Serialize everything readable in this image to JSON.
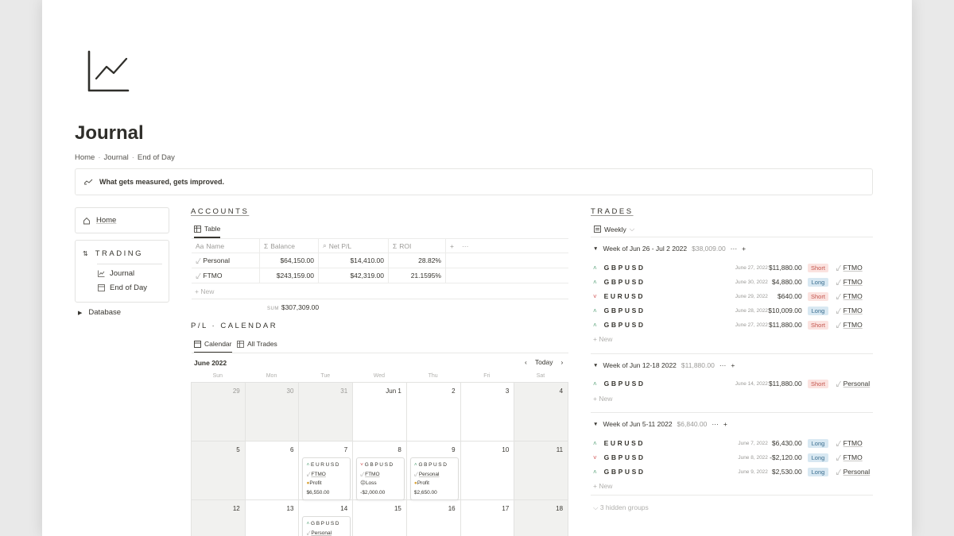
{
  "page": {
    "title": "Journal",
    "breadcrumb": [
      "Home",
      "Journal",
      "End of Day"
    ],
    "callout": "What gets measured, gets improved."
  },
  "nav": {
    "home": "Home",
    "trading_header": "TRADING",
    "trading_items": [
      "Journal",
      "End of Day"
    ],
    "database": "Database"
  },
  "accounts": {
    "header": "ACCOUNTS",
    "view_tab": "Table",
    "columns": [
      "Name",
      "Balance",
      "Net P/L",
      "ROI"
    ],
    "rows": [
      {
        "name": "Personal",
        "balance": "$64,150.00",
        "net": "$14,410.00",
        "roi": "28.82%"
      },
      {
        "name": "FTMO",
        "balance": "$243,159.00",
        "net": "$42,319.00",
        "roi": "21.1595%"
      }
    ],
    "new_label": "New",
    "sum_key": "SUM",
    "sum_value": "$307,309.00"
  },
  "calendar": {
    "header": "P/L · CALENDAR",
    "tabs": [
      "Calendar",
      "All Trades"
    ],
    "month": "June 2022",
    "today": "Today",
    "dows": [
      "Sun",
      "Mon",
      "Tue",
      "Wed",
      "Thu",
      "Fri",
      "Sat"
    ],
    "weeks": [
      [
        "29",
        "30",
        "31",
        "Jun 1",
        "2",
        "3",
        "4"
      ],
      [
        "5",
        "6",
        "7",
        "8",
        "9",
        "10",
        "11"
      ],
      [
        "12",
        "13",
        "14",
        "15",
        "16",
        "17",
        "18"
      ]
    ],
    "cards": [
      {
        "ticker": "EURUSD",
        "account": "FTMO",
        "result": "Profit",
        "amount": "$6,550.00"
      },
      {
        "ticker": "GBPUSD",
        "account": "FTMO",
        "result": "Loss",
        "amount": "-$2,000.00"
      },
      {
        "ticker": "GBPUSD",
        "account": "Personal",
        "result": "Profit",
        "amount": "$2,650.00"
      },
      {
        "ticker": "GBPUSD",
        "account": "Personal"
      }
    ]
  },
  "trades": {
    "header": "TRADES",
    "view": "Weekly",
    "new_label": "New",
    "hidden_groups": "3 hidden groups",
    "groups": [
      {
        "title": "Week of Jun 26 - Jul 2 2022",
        "sum": "$38,009.00",
        "rows": [
          {
            "dir": "up",
            "ticker": "GBPUSD",
            "date": "June 27, 2022",
            "amount": "$11,880.00",
            "side": "Short",
            "account": "FTMO"
          },
          {
            "dir": "up",
            "ticker": "GBPUSD",
            "date": "June 30, 2022",
            "amount": "$4,880.00",
            "side": "Long",
            "account": "FTMO"
          },
          {
            "dir": "down",
            "ticker": "EURUSD",
            "date": "June 29, 2022",
            "amount": "$640.00",
            "side": "Short",
            "account": "FTMO"
          },
          {
            "dir": "up",
            "ticker": "GBPUSD",
            "date": "June 28, 2022",
            "amount": "$10,009.00",
            "side": "Long",
            "account": "FTMO"
          },
          {
            "dir": "up",
            "ticker": "GBPUSD",
            "date": "June 27, 2022",
            "amount": "$11,880.00",
            "side": "Short",
            "account": "FTMO"
          }
        ]
      },
      {
        "title": "Week of Jun 12-18 2022",
        "sum": "$11,880.00",
        "rows": [
          {
            "dir": "up",
            "ticker": "GBPUSD",
            "date": "June 14, 2022",
            "amount": "$11,880.00",
            "side": "Short",
            "account": "Personal"
          }
        ]
      },
      {
        "title": "Week of Jun 5-11 2022",
        "sum": "$6,840.00",
        "rows": [
          {
            "dir": "up",
            "ticker": "EURUSD",
            "date": "June 7, 2022",
            "amount": "$6,430.00",
            "side": "Long",
            "account": "FTMO"
          },
          {
            "dir": "down",
            "ticker": "GBPUSD",
            "date": "June 8, 2022",
            "amount": "-$2,120.00",
            "side": "Long",
            "account": "FTMO"
          },
          {
            "dir": "up",
            "ticker": "GBPUSD",
            "date": "June 9, 2022",
            "amount": "$2,530.00",
            "side": "Long",
            "account": "Personal"
          }
        ]
      }
    ]
  }
}
